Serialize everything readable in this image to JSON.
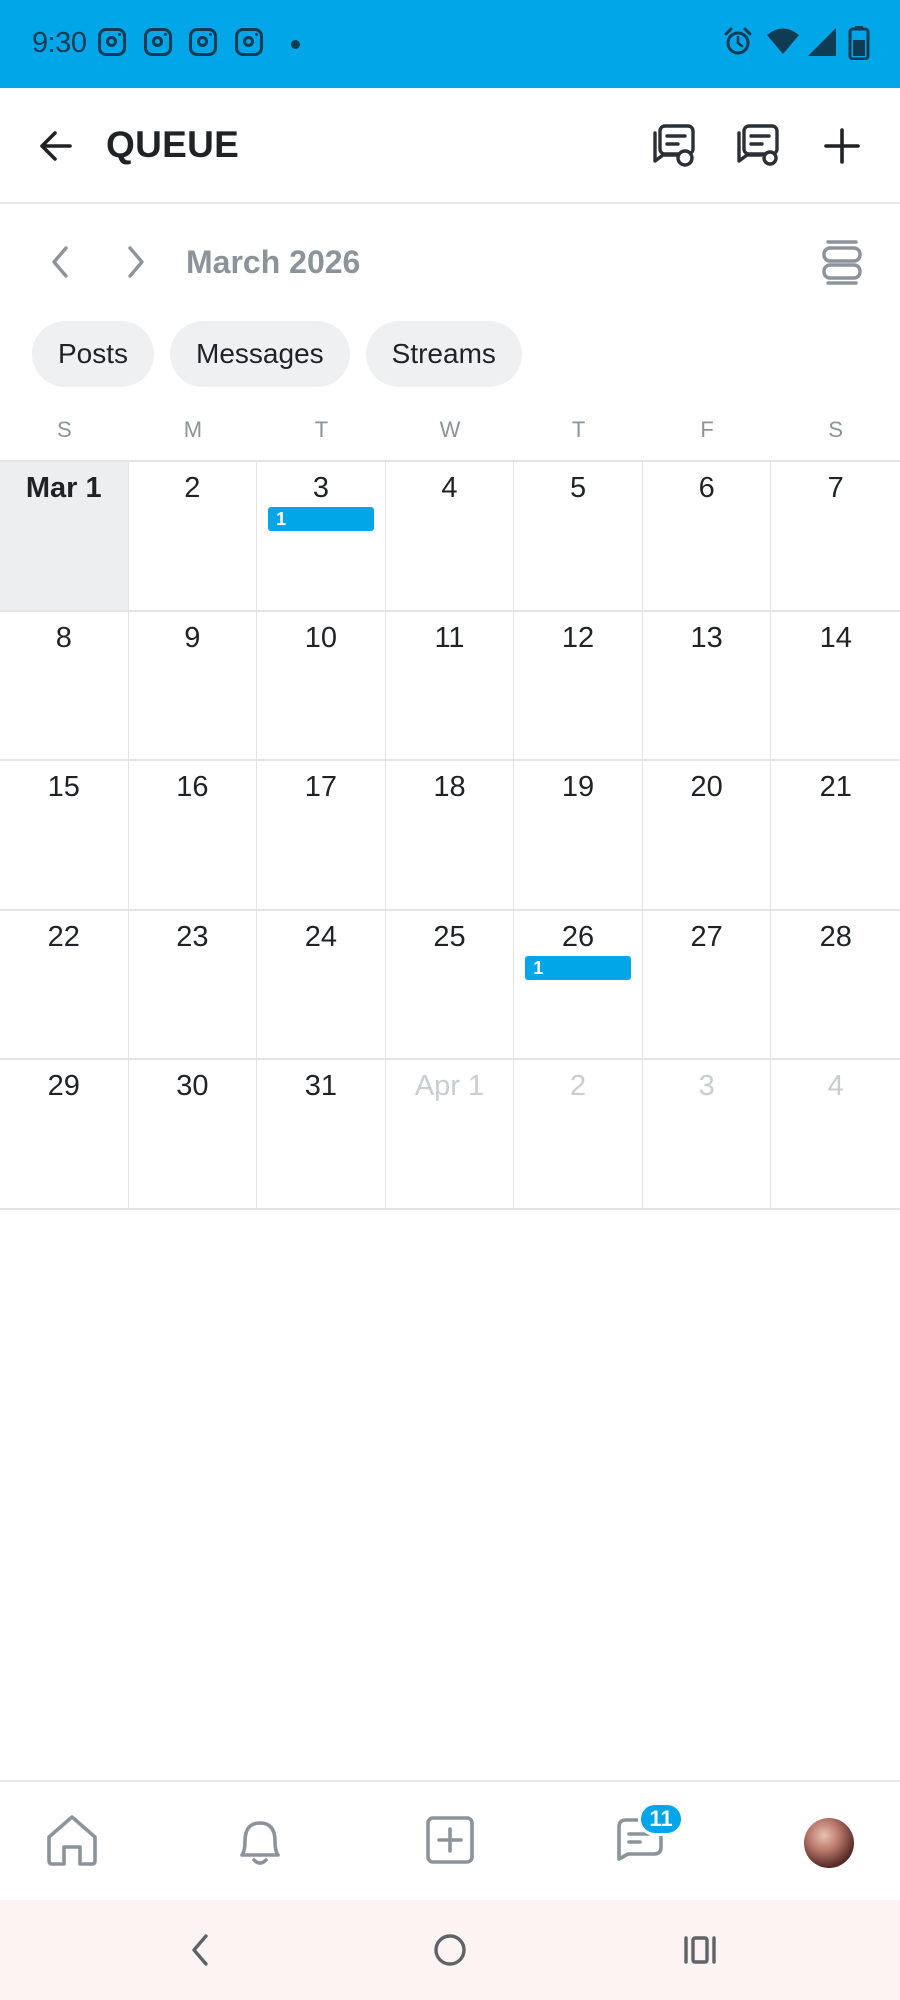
{
  "status_bar": {
    "time": "9:30",
    "notification_icons": [
      "instagram-icon",
      "instagram-icon",
      "instagram-icon",
      "instagram-icon"
    ],
    "right_icons": [
      "alarm-icon",
      "wifi-icon",
      "signal-icon",
      "battery-icon"
    ],
    "color": "#00a6e8"
  },
  "header": {
    "title": "QUEUE",
    "icons": [
      "back-arrow-icon",
      "schedule-list-icon",
      "schedule-settings-icon",
      "add-icon"
    ]
  },
  "calendar": {
    "month_label": "March 2026",
    "weekdays": [
      "S",
      "M",
      "T",
      "W",
      "T",
      "F",
      "S"
    ],
    "weeks": [
      [
        {
          "label": "Mar 1",
          "today": true
        },
        {
          "label": "2"
        },
        {
          "label": "3",
          "event": "1"
        },
        {
          "label": "4"
        },
        {
          "label": "5"
        },
        {
          "label": "6"
        },
        {
          "label": "7"
        }
      ],
      [
        {
          "label": "8"
        },
        {
          "label": "9"
        },
        {
          "label": "10"
        },
        {
          "label": "11"
        },
        {
          "label": "12"
        },
        {
          "label": "13"
        },
        {
          "label": "14"
        }
      ],
      [
        {
          "label": "15"
        },
        {
          "label": "16"
        },
        {
          "label": "17"
        },
        {
          "label": "18"
        },
        {
          "label": "19"
        },
        {
          "label": "20"
        },
        {
          "label": "21"
        }
      ],
      [
        {
          "label": "22"
        },
        {
          "label": "23"
        },
        {
          "label": "24"
        },
        {
          "label": "25"
        },
        {
          "label": "26",
          "event": "1"
        },
        {
          "label": "27"
        },
        {
          "label": "28"
        }
      ],
      [
        {
          "label": "29"
        },
        {
          "label": "30"
        },
        {
          "label": "31"
        },
        {
          "label": "Apr 1",
          "outside": true
        },
        {
          "label": "2",
          "outside": true
        },
        {
          "label": "3",
          "outside": true
        },
        {
          "label": "4",
          "outside": true
        }
      ]
    ],
    "event_color": "#00a6e8"
  },
  "filters": {
    "chips": [
      "Posts",
      "Messages",
      "Streams"
    ]
  },
  "bottom_nav": {
    "items": [
      "home-icon",
      "bell-icon",
      "add-post-icon",
      "messages-icon",
      "profile-avatar"
    ],
    "messages_badge": "11"
  },
  "system_nav": {
    "buttons": [
      "back",
      "home",
      "recents"
    ]
  }
}
